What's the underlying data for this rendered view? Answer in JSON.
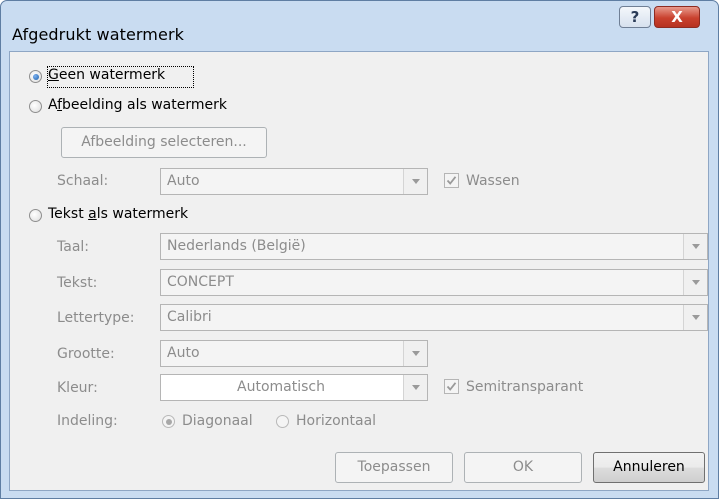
{
  "window": {
    "title": "Afgedrukt watermerk",
    "help_glyph": "?",
    "close_glyph": "X"
  },
  "options": {
    "none": {
      "label_u": "G",
      "label_rest": "een watermerk",
      "selected": true
    },
    "picture": {
      "label_pre": "A",
      "label_u": "f",
      "label_rest": "beelding als watermerk",
      "selected": false
    },
    "text": {
      "label_pre": "Tekst ",
      "label_u": "a",
      "label_rest": "ls watermerk",
      "selected": false
    }
  },
  "picture_section": {
    "select_button": "Afbeelding selecteren...",
    "scale_label": "Schaal:",
    "scale_value": "Auto",
    "washout_label": "Wassen",
    "washout_checked": true
  },
  "text_section": {
    "language_label": "Taal:",
    "language_value": "Nederlands (België)",
    "text_label": "Tekst:",
    "text_value": "CONCEPT",
    "font_label": "Lettertype:",
    "font_value": "Calibri",
    "size_label": "Grootte:",
    "size_value": "Auto",
    "color_label": "Kleur:",
    "color_value": "Automatisch",
    "semitransparent_label": "Semitransparant",
    "semitransparent_checked": true,
    "layout_label": "Indeling:",
    "layout_options": [
      "Diagonaal",
      "Horizontaal"
    ],
    "layout_selected": "Diagonaal"
  },
  "buttons": {
    "apply": "Toepassen",
    "ok": "OK",
    "cancel": "Annuleren"
  },
  "colors": {
    "frame": "#c9dcf1",
    "close_button": "#c9412e",
    "disabled_text": "#8c8c8c"
  }
}
